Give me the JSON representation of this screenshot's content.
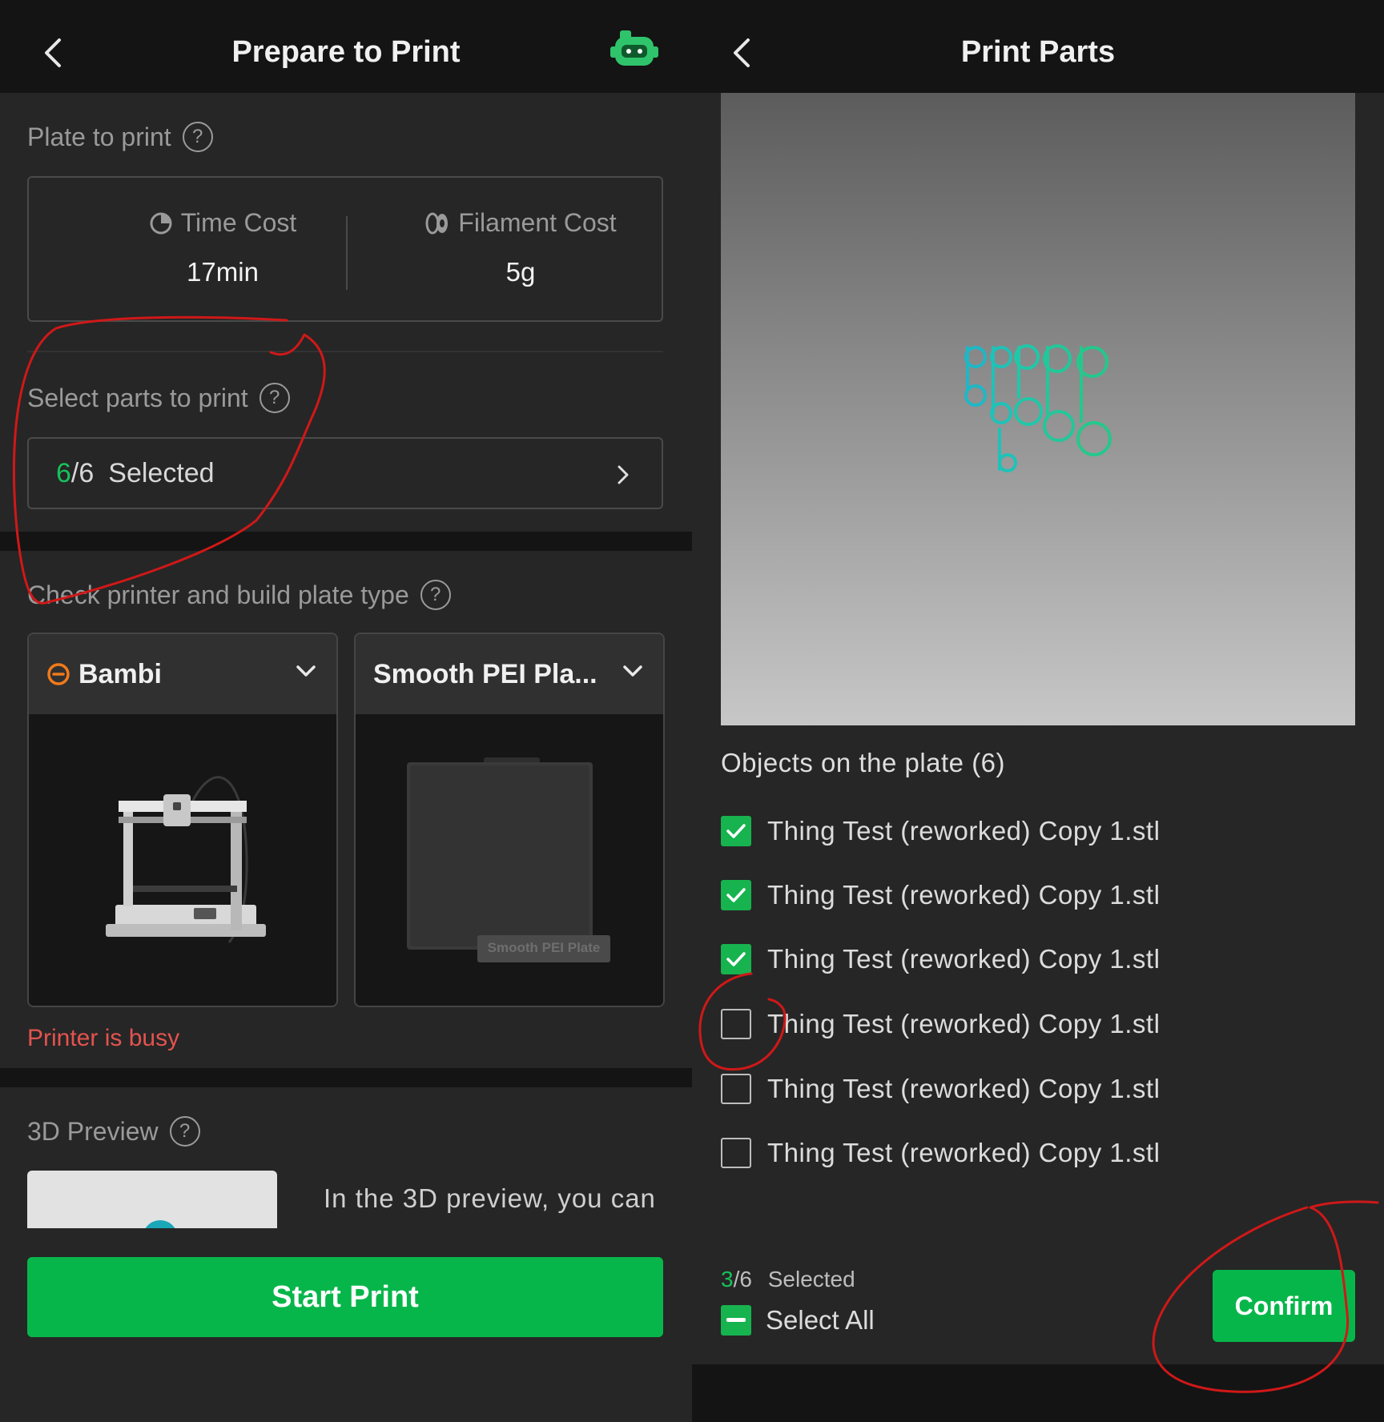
{
  "left_screen": {
    "header": {
      "title": "Prepare to Print"
    },
    "plate": {
      "label": "Plate to print",
      "help_glyph": "?",
      "time_cost_label": "Time Cost",
      "time_cost_value": "17min",
      "filament_cost_label": "Filament Cost",
      "filament_cost_value": "5g"
    },
    "parts": {
      "label": "Select parts to print",
      "help_glyph": "?",
      "selected_count": "6",
      "total": "/6",
      "selected_label": "Selected"
    },
    "printer": {
      "label": "Check printer and build plate type",
      "help_glyph": "?",
      "printer_name": "Bambi",
      "plate_type": "Smooth PEI Pla...",
      "plate_image_caption": "Smooth PEI Plate",
      "status": "Printer is busy"
    },
    "preview": {
      "label": "3D Preview",
      "help_glyph": "?",
      "description": "In the 3D preview, you can"
    },
    "start_button": "Start Print"
  },
  "right_screen": {
    "header": {
      "title": "Print Parts"
    },
    "objects_title": "Objects on the plate (6)",
    "objects": [
      {
        "name": "Thing Test (reworked) Copy 1.stl",
        "checked": true
      },
      {
        "name": "Thing Test (reworked) Copy 1.stl",
        "checked": true
      },
      {
        "name": "Thing Test (reworked) Copy 1.stl",
        "checked": true
      },
      {
        "name": "Thing Test (reworked) Copy 1.stl",
        "checked": false
      },
      {
        "name": "Thing Test (reworked) Copy 1.stl",
        "checked": false
      },
      {
        "name": "Thing Test (reworked) Copy 1.stl",
        "checked": false
      }
    ],
    "selected_count": "3",
    "total": "/6",
    "selected_label": "Selected",
    "select_all_label": "Select All",
    "confirm_button": "Confirm"
  },
  "colors": {
    "accent_green": "#07b64a",
    "error_red": "#e4534f",
    "annotation_red": "#d01818",
    "model_teal": "#1fc4b0"
  }
}
